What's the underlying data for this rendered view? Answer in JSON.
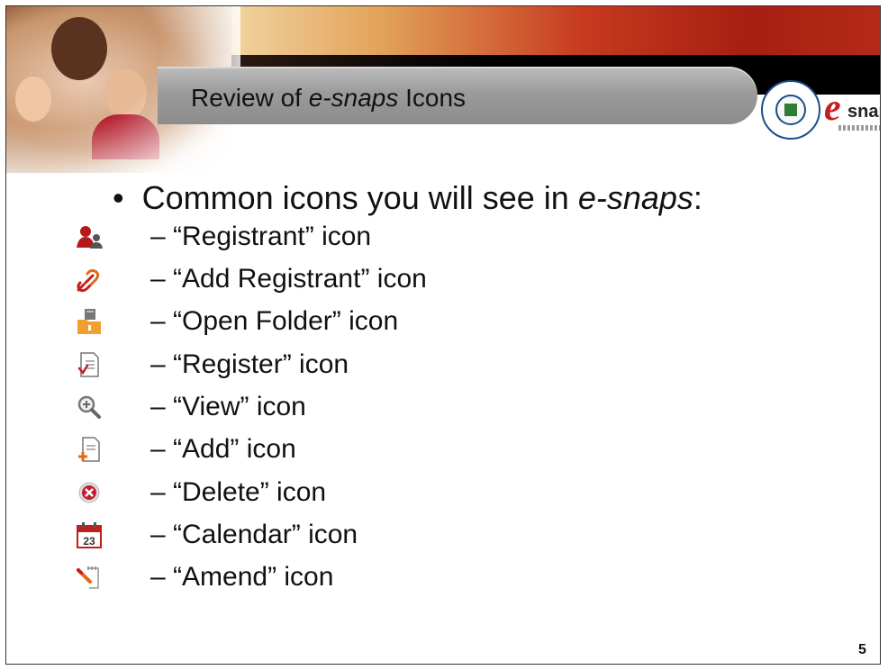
{
  "header": {
    "title_prefix": "Review of ",
    "title_italic": "e-snaps",
    "title_suffix": " Icons",
    "logo_e": "e",
    "logo_text": "snaps"
  },
  "intro": {
    "bullet": "•",
    "text_prefix": "Common icons you will see in ",
    "text_italic": "e-snaps",
    "text_suffix": ":"
  },
  "items": [
    {
      "label": "– “Registrant” icon",
      "icon": "registrant-icon"
    },
    {
      "label": "– “Add Registrant” icon",
      "icon": "add-registrant-icon"
    },
    {
      "label": "– “Open Folder” icon",
      "icon": "open-folder-icon"
    },
    {
      "label": "– “Register” icon",
      "icon": "register-icon"
    },
    {
      "label": "– “View” icon",
      "icon": "view-icon"
    },
    {
      "label": "– “Add” icon",
      "icon": "add-icon"
    },
    {
      "label": "– “Delete” icon",
      "icon": "delete-icon"
    },
    {
      "label": "– “Calendar” icon",
      "icon": "calendar-icon"
    },
    {
      "label": "– “Amend” icon",
      "icon": "amend-icon"
    }
  ],
  "calendar_day": "23",
  "page_number": "5",
  "colors": {
    "accent_red": "#c41e1e",
    "title_bar": "#9b9b9b",
    "folder_orange": "#f0a030"
  }
}
